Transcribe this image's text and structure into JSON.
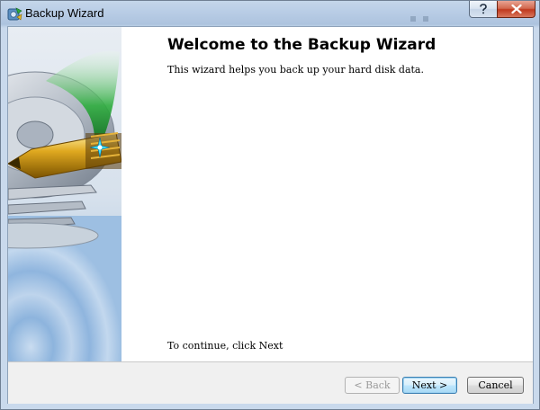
{
  "window": {
    "title": "Backup Wizard"
  },
  "wizard": {
    "heading": "Welcome to the Backup Wizard",
    "description": "This wizard helps you back up your hard disk data.",
    "continue_hint": "To continue, click Next"
  },
  "buttons": {
    "back": "< Back",
    "next": "Next >",
    "cancel": "Cancel"
  },
  "icons": {
    "app": "backup-app-icon",
    "help": "question-mark-icon",
    "close": "close-x-icon",
    "side_image": "hard-disk-with-golden-pen-illustration"
  },
  "colors": {
    "accent_blue": "#3c7fb1",
    "close_red": "#c0391e",
    "side_green": "#1f9e32",
    "pen_gold": "#d4a017"
  }
}
